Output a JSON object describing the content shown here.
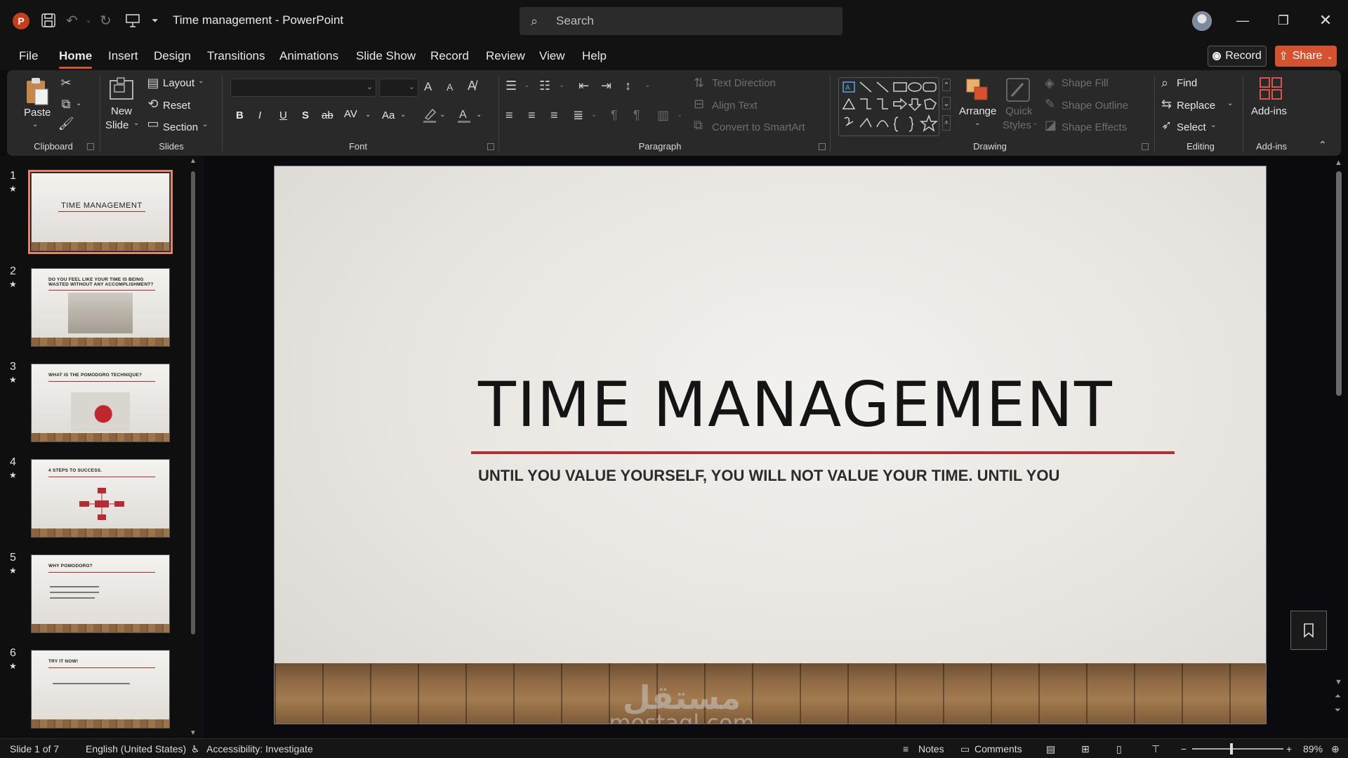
{
  "titlebar": {
    "doc_title": "Time management  -  PowerPoint",
    "search_placeholder": "Search",
    "app_badge": "P"
  },
  "tabs": [
    "File",
    "Home",
    "Insert",
    "Design",
    "Transitions",
    "Animations",
    "Slide Show",
    "Record",
    "Review",
    "View",
    "Help"
  ],
  "active_tab": "Home",
  "top_buttons": {
    "record": "Record",
    "share": "Share"
  },
  "ribbon": {
    "clipboard": {
      "paste": "Paste",
      "label": "Clipboard"
    },
    "slides": {
      "new_slide_1": "New",
      "new_slide_2": "Slide",
      "layout": "Layout",
      "reset": "Reset",
      "section": "Section",
      "label": "Slides"
    },
    "font": {
      "label": "Font",
      "bold": "B",
      "italic": "I",
      "underline": "U",
      "shadow": "S",
      "strike": "ab",
      "spacing": "AV",
      "case": "Aa",
      "grow": "A",
      "shrink": "A"
    },
    "paragraph": {
      "label": "Paragraph",
      "text_direction": "Text Direction",
      "align_text": "Align Text",
      "convert_smartart": "Convert to SmartArt"
    },
    "drawing": {
      "label": "Drawing",
      "arrange": "Arrange",
      "quick_styles_1": "Quick",
      "quick_styles_2": "Styles",
      "shape_fill": "Shape Fill",
      "shape_outline": "Shape Outline",
      "shape_effects": "Shape Effects"
    },
    "editing": {
      "label": "Editing",
      "find": "Find",
      "replace": "Replace",
      "select": "Select"
    },
    "addins": {
      "label": "Add-ins",
      "button": "Add-ins"
    }
  },
  "thumbnails": [
    {
      "num": "1",
      "title": "TIME MANAGEMENT"
    },
    {
      "num": "2",
      "title": "DO YOU FEEL LIKE YOUR TIME IS BEING WASTED WITHOUT ANY ACCOMPLISHMENT?"
    },
    {
      "num": "3",
      "title": "WHAT IS THE POMODORO TECHNIQUE?"
    },
    {
      "num": "4",
      "title": "4 STEPS TO SUCCESS."
    },
    {
      "num": "5",
      "title": "WHY POMODORO?"
    },
    {
      "num": "6",
      "title": "TRY IT NOW!"
    }
  ],
  "slide": {
    "title": "TIME MANAGEMENT",
    "subtitle": "UNTIL YOU VALUE YOURSELF, YOU WILL NOT VALUE YOUR TIME. UNTIL YOU",
    "watermark_ar": "مستقل",
    "watermark_en": "mostaql.com"
  },
  "status": {
    "slide_of": "Slide 1 of 7",
    "language": "English (United States)",
    "accessibility": "Accessibility: Investigate",
    "notes": "Notes",
    "comments": "Comments",
    "zoom": "89%",
    "zoom_value": 0.89
  },
  "colors": {
    "accent": "#d35230",
    "slide_rule": "#b32d34"
  }
}
